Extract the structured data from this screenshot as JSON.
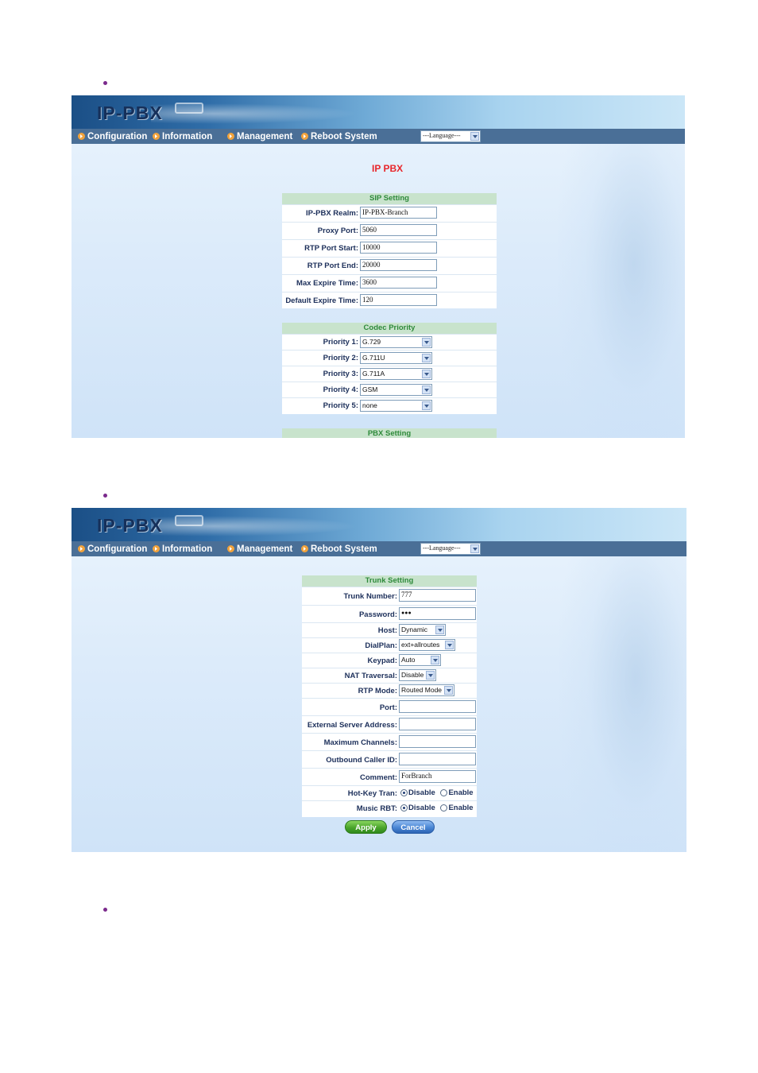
{
  "app": {
    "logo": "IP-PBX"
  },
  "nav": {
    "items": [
      "Configuration",
      "Information",
      "Management",
      "Reboot System"
    ],
    "language": "---Language---"
  },
  "screen1": {
    "title": "IP PBX",
    "sip": {
      "heading": "SIP Setting",
      "fields": [
        {
          "label": "IP-PBX Realm:",
          "value": "IP-PBX-Branch"
        },
        {
          "label": "Proxy Port:",
          "value": "5060"
        },
        {
          "label": "RTP Port Start:",
          "value": "10000"
        },
        {
          "label": "RTP Port End:",
          "value": "20000"
        },
        {
          "label": "Max Expire Time:",
          "value": "3600"
        },
        {
          "label": "Default Expire Time:",
          "value": "120"
        }
      ]
    },
    "codec": {
      "heading": "Codec Priority",
      "fields": [
        {
          "label": "Priority 1:",
          "value": "G.729"
        },
        {
          "label": "Priority 2:",
          "value": "G.711U"
        },
        {
          "label": "Priority 3:",
          "value": "G.711A"
        },
        {
          "label": "Priority 4:",
          "value": "GSM"
        },
        {
          "label": "Priority 5:",
          "value": "none"
        }
      ]
    },
    "pbx_heading": "PBX Setting"
  },
  "screen2": {
    "trunk": {
      "heading": "Trunk Setting",
      "trunk_number": {
        "label": "Trunk Number:",
        "value": "777"
      },
      "password": {
        "label": "Password:",
        "value": "●●●"
      },
      "host": {
        "label": "Host:",
        "value": "Dynamic"
      },
      "dialplan": {
        "label": "DialPlan:",
        "value": "ext+allroutes"
      },
      "keypad": {
        "label": "Keypad:",
        "value": "Auto"
      },
      "nat": {
        "label": "NAT Traversal:",
        "value": "Disable"
      },
      "rtp_mode": {
        "label": "RTP Mode:",
        "value": "Routed Mode"
      },
      "port": {
        "label": "Port:",
        "value": ""
      },
      "ext_server": {
        "label": "External Server Address:",
        "value": ""
      },
      "max_channels": {
        "label": "Maximum Channels:",
        "value": ""
      },
      "caller_id": {
        "label": "Outbound Caller ID:",
        "value": ""
      },
      "comment": {
        "label": "Comment:",
        "value": "ForBranch"
      },
      "hotkey": {
        "label": "Hot-Key Tran:",
        "options": [
          "Disable",
          "Enable"
        ],
        "selected": "Disable"
      },
      "music_rbt": {
        "label": "Music RBT:",
        "options": [
          "Disable",
          "Enable"
        ],
        "selected": "Disable"
      }
    },
    "buttons": {
      "apply": "Apply",
      "cancel": "Cancel"
    }
  }
}
